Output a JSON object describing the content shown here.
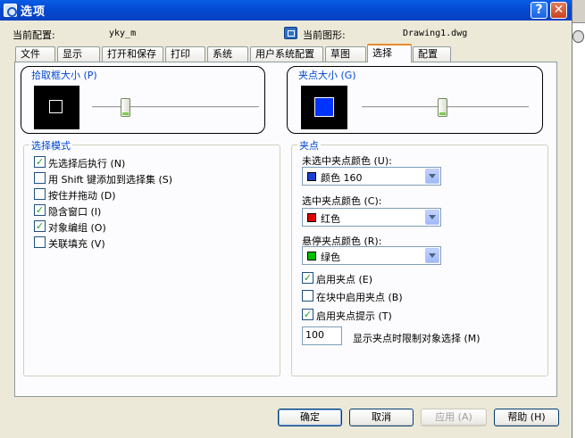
{
  "window": {
    "title": "选项",
    "help_glyph": "?",
    "close_glyph": "✕"
  },
  "header": {
    "current_profile_label": "当前配置:",
    "current_profile_value": "yky_m",
    "current_drawing_label": "当前图形:",
    "current_drawing_value": "Drawing1.dwg"
  },
  "tabs": [
    {
      "label": "文件"
    },
    {
      "label": "显示"
    },
    {
      "label": "打开和保存"
    },
    {
      "label": "打印"
    },
    {
      "label": "系统"
    },
    {
      "label": "用户系统配置"
    },
    {
      "label": "草图"
    },
    {
      "label": "选择",
      "active": true
    },
    {
      "label": "配置"
    }
  ],
  "pickbox": {
    "title": "拾取框大小 (P)",
    "slider_level": 0.2
  },
  "grip_size": {
    "title": "夹点大小 (G)",
    "slider_level": 0.48
  },
  "selection_modes": {
    "title": "选择模式",
    "items": [
      {
        "label": "先选择后执行 (N)",
        "checked": true
      },
      {
        "label": "用 Shift 键添加到选择集 (S)",
        "checked": false
      },
      {
        "label": "按住并拖动 (D)",
        "checked": false
      },
      {
        "label": "隐含窗口 (I)",
        "checked": true
      },
      {
        "label": "对象编组 (O)",
        "checked": true
      },
      {
        "label": "关联填充 (V)",
        "checked": false
      }
    ]
  },
  "grips": {
    "title": "夹点",
    "unselected_label": "未选中夹点颜色 (U):",
    "unselected_value": "颜色 160",
    "unselected_color": "#1a3fd4",
    "selected_label": "选中夹点颜色 (C):",
    "selected_value": "红色",
    "selected_color": "#e00000",
    "hover_label": "悬停夹点颜色 (R):",
    "hover_value": "绿色",
    "hover_color": "#00c000",
    "checks": [
      {
        "label": "启用夹点 (E)",
        "checked": true
      },
      {
        "label": "在块中启用夹点 (B)",
        "checked": false
      },
      {
        "label": "启用夹点提示 (T)",
        "checked": true
      }
    ],
    "limit_value": "100",
    "limit_label": "显示夹点时限制对象选择 (M)"
  },
  "buttons": {
    "ok": "确定",
    "cancel": "取消",
    "apply": "应用 (A)",
    "help": "帮助 (H)"
  },
  "colors": {
    "titlebar": "#0449d2",
    "dialog_bg": "#ece9d8",
    "group_title": "#0046d5",
    "grip_preview": "#0033ff"
  },
  "check_glyph": "✓"
}
